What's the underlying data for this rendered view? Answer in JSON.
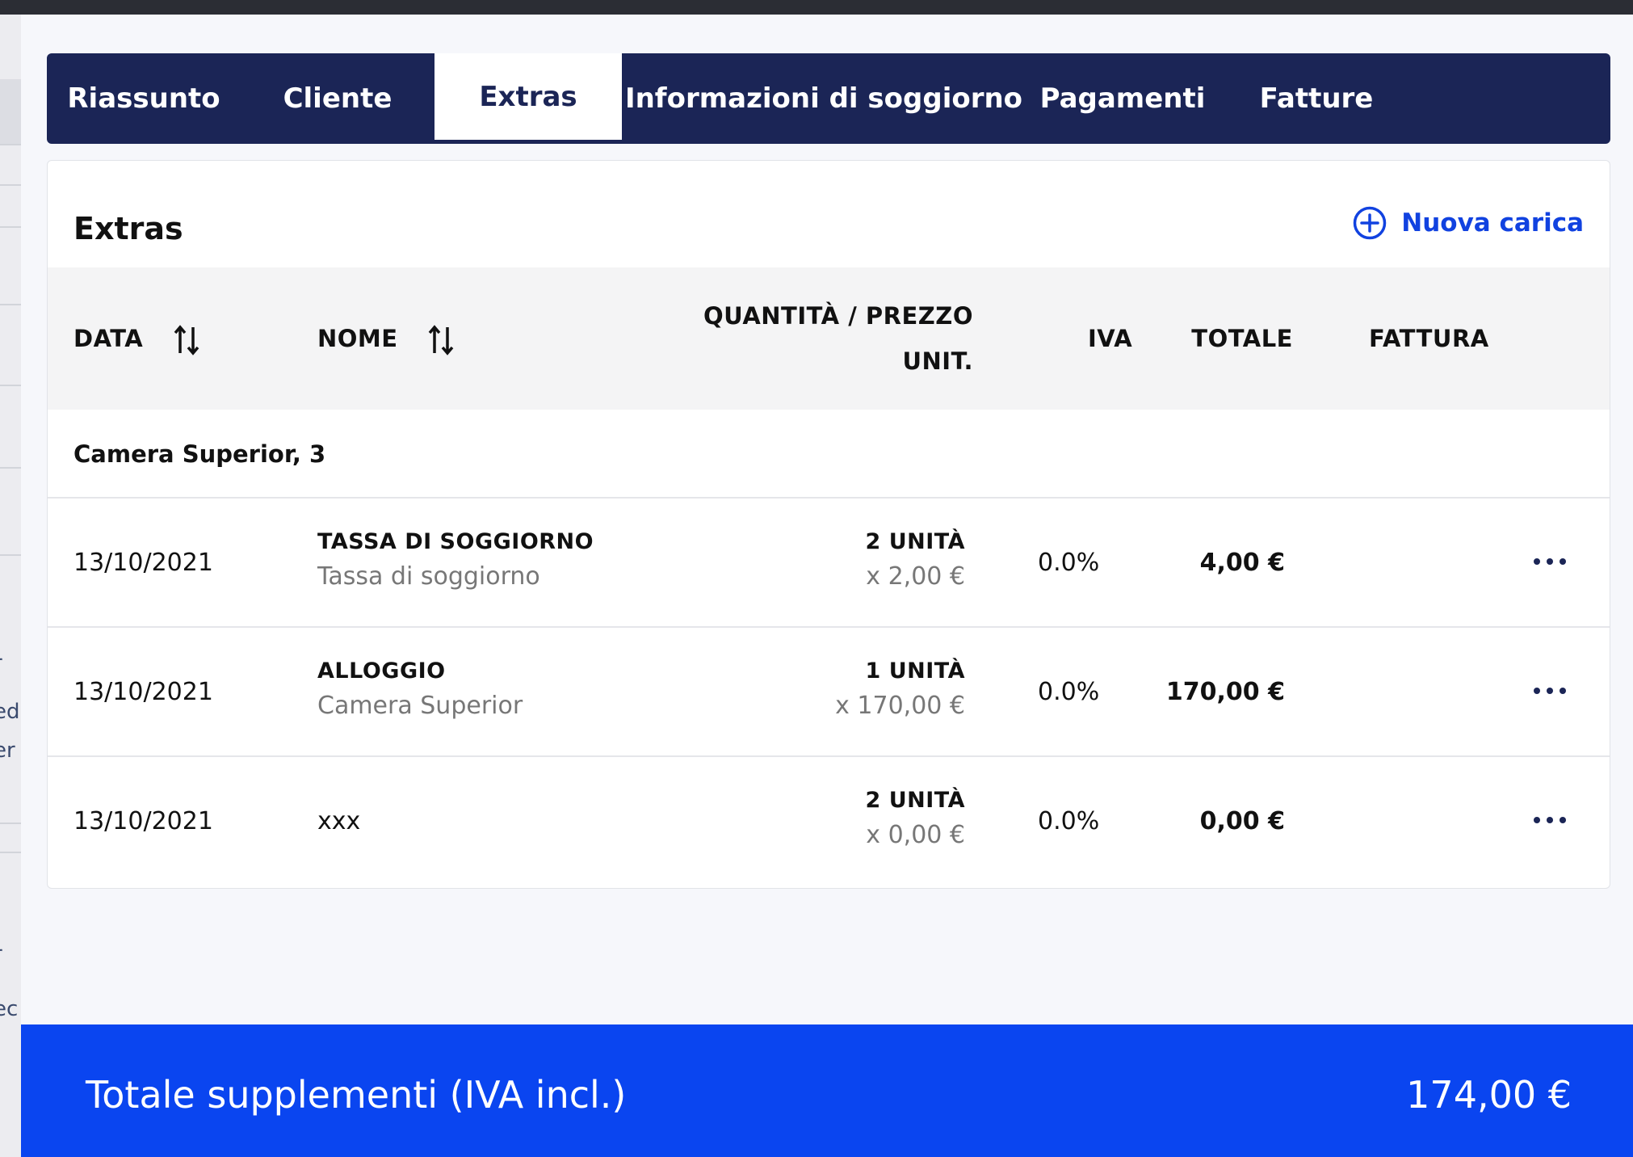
{
  "tabs": [
    {
      "label": "Riassunto",
      "active": false
    },
    {
      "label": "Cliente",
      "active": false
    },
    {
      "label": "Extras",
      "active": true
    },
    {
      "label": "Informazioni di soggiorno",
      "active": false
    },
    {
      "label": "Pagamenti",
      "active": false
    },
    {
      "label": "Fatture",
      "active": false
    }
  ],
  "card": {
    "title": "Extras",
    "new_charge_label": "Nuova carica",
    "new_charge_icon": "plus-circle-icon"
  },
  "table": {
    "headers": {
      "date": "DATA",
      "name": "NOME",
      "qty_line1": "QUANTITÀ / PREZZO",
      "qty_line2": "UNIT.",
      "vat": "IVA",
      "total": "TOTALE",
      "invoice": "FATTURA"
    },
    "group": "Camera Superior, 3",
    "rows": [
      {
        "date": "13/10/2021",
        "name": "TASSA DI SOGGIORNO",
        "description": "Tassa di soggiorno",
        "qty": "2 UNITÀ",
        "unit_price": "x 2,00 €",
        "vat": "0.0%",
        "total": "4,00 €"
      },
      {
        "date": "13/10/2021",
        "name": "ALLOGGIO",
        "description": "Camera Superior",
        "qty": "1 UNITÀ",
        "unit_price": "x 170,00 €",
        "vat": "0.0%",
        "total": "170,00 €"
      },
      {
        "date": "13/10/2021",
        "name": "xxx",
        "description": "",
        "qty": "2 UNITÀ",
        "unit_price": "x 0,00 €",
        "vat": "0.0%",
        "total": "0,00 €"
      }
    ]
  },
  "footer": {
    "label": "Totale supplementi (IVA incl.)",
    "value": "174,00 €"
  },
  "colors": {
    "nav": "#1b2556",
    "accent": "#1142e0",
    "footer": "#0a45f0"
  }
}
